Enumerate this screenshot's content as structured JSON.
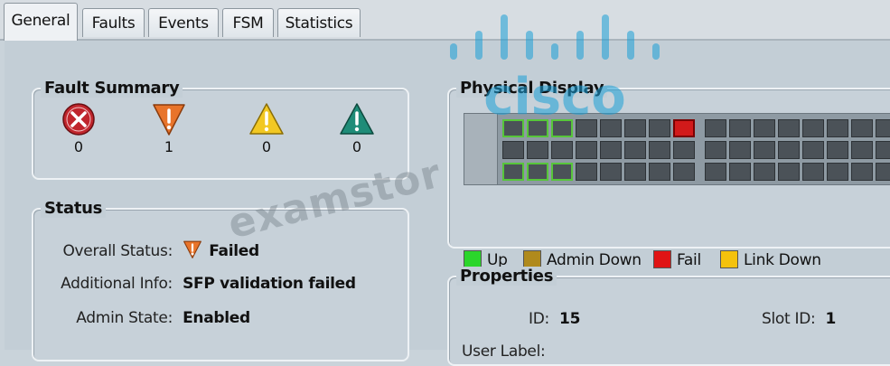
{
  "tabs": [
    {
      "label": "General",
      "active": true
    },
    {
      "label": "Faults"
    },
    {
      "label": "Events"
    },
    {
      "label": "FSM"
    },
    {
      "label": "Statistics"
    }
  ],
  "fault_summary": {
    "title": "Fault Summary",
    "items": [
      {
        "severity": "critical",
        "icon": "critical-fault-icon",
        "color": "#c0252c",
        "count": "0"
      },
      {
        "severity": "major",
        "icon": "major-fault-icon",
        "color": "#e8742b",
        "count": "1"
      },
      {
        "severity": "minor",
        "icon": "minor-fault-icon",
        "color": "#f2c823",
        "count": "0"
      },
      {
        "severity": "warning",
        "icon": "warning-fault-icon",
        "color": "#1f8c78",
        "count": "0"
      }
    ]
  },
  "status": {
    "title": "Status",
    "overall_label": "Overall Status:",
    "overall_value": "Failed",
    "additional_label": "Additional Info:",
    "additional_value": "SFP validation failed",
    "admin_label": "Admin State:",
    "admin_value": "Enabled"
  },
  "physical_display": {
    "title": "Physical Display",
    "legend": [
      {
        "label": "Up",
        "color": "#2bd62b"
      },
      {
        "label": "Admin Down",
        "color": "#b08a1c"
      },
      {
        "label": "Fail",
        "color": "#e01414"
      },
      {
        "label": "Link Down",
        "color": "#f4c20d"
      }
    ]
  },
  "properties": {
    "title": "Properties",
    "id_label": "ID:",
    "id_value": "15",
    "slot_label": "Slot ID:",
    "slot_value": "1",
    "user_label_partial": "User Label:"
  },
  "overlay": {
    "logo_text": "cisco",
    "watermark": "examstor"
  }
}
